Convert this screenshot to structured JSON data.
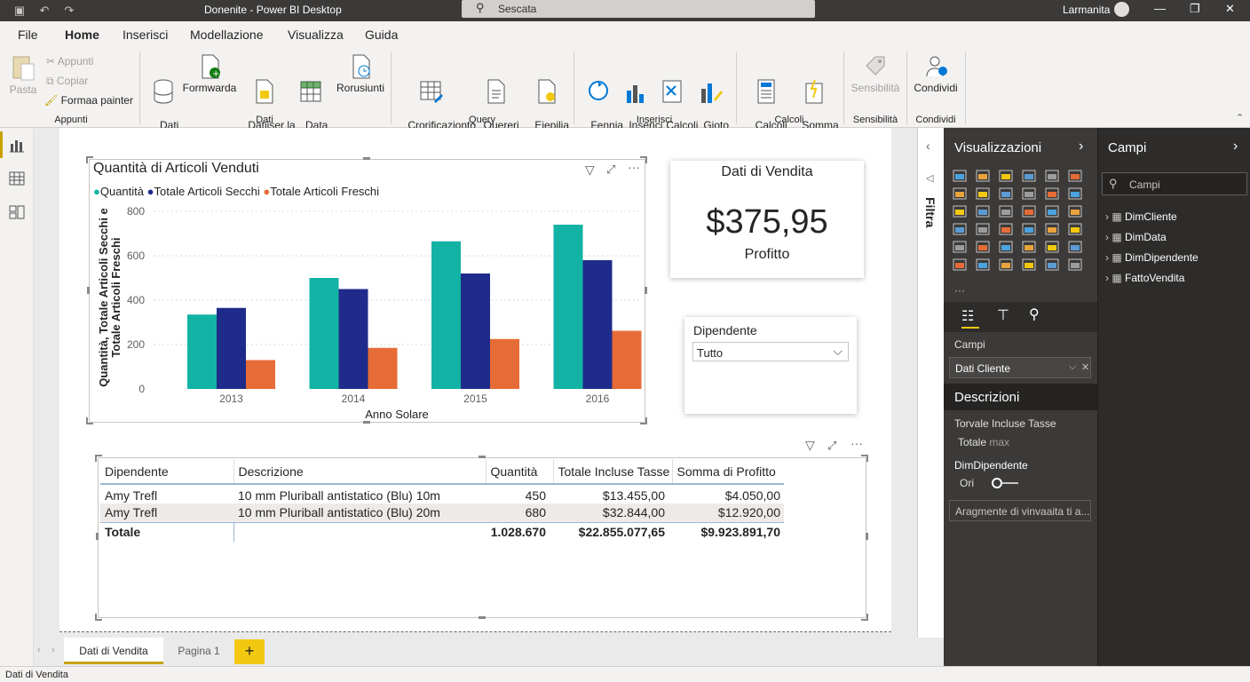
{
  "titlebar": {
    "title": "Donenite - Power BI Desktop",
    "search_placeholder": "Sescata",
    "user": "Larmanita"
  },
  "menu": {
    "tabs": [
      "File",
      "Home",
      "Inserisci",
      "Modellazione",
      "Visualizza",
      "Guida"
    ],
    "active": "Home"
  },
  "ribbon": {
    "paste": "Pasta",
    "cut": "Appunti",
    "copy": "Copiar",
    "format_painter": "Formaa painter",
    "group_clipboard": "Appunti",
    "get_data": "Dati\ndati ˅",
    "forward": "Formwarda",
    "datasets": "Datiiser la\nvato dati",
    "new_data": "Data\nnunestico",
    "recent": "Rorusiunti",
    "group_data": "Dati",
    "query_edit": "Crorificazionto\nquery ˅",
    "queries": "Quereri\nmomazioni",
    "insert_ex": "Eiepilia\ninsertorti",
    "group_query": "Query",
    "fennia": "Fennia\n˅",
    "insert": "Inserici\n˅",
    "calcoli": "Calcoli\n˅",
    "giotovani": "Gioto\nvani ˅",
    "group_insert": "Inserisci",
    "calc_cols": "Calcoli\ncoluziumi",
    "sum_profit": "Somma\ndi Profitte",
    "group_calc": "Calcoli",
    "sensitivity": "Sensibilità",
    "group_sens": "Sensibilità",
    "share": "Condividi",
    "group_share": "Condividi"
  },
  "chart_data": {
    "type": "bar",
    "title": "Quantità di Articoli Venduti",
    "categories": [
      "2013",
      "2014",
      "2015",
      "2016"
    ],
    "series": [
      {
        "name": "Quantità",
        "color": "#12b3a5",
        "values": [
          335,
          500,
          665,
          740
        ]
      },
      {
        "name": "Totale Articoli Secchi",
        "color": "#1f2b8a",
        "values": [
          365,
          450,
          520,
          580
        ]
      },
      {
        "name": "Totale Articoli Freschi",
        "color": "#e66c37",
        "values": [
          130,
          185,
          225,
          262
        ]
      }
    ],
    "xlabel": "Anno Solare",
    "ylabel": "Quantità, Totale Articoli Secchi e Totale Articoli Freschi",
    "ylim": [
      0,
      800
    ],
    "yticks": [
      "800",
      "600",
      "400",
      "200",
      "0"
    ],
    "grid": true,
    "legend": "top-left"
  },
  "kpi": {
    "title": "Dati di Vendita",
    "value": "$375,95",
    "label": "Profitto"
  },
  "slicer": {
    "title": "Dipendente",
    "value": "Tutto"
  },
  "table": {
    "headers": [
      "Dipendente",
      "Descrizione",
      "Quantità",
      "Totale Incluse Tasse",
      "Somma di Profitto"
    ],
    "rows": [
      [
        "Amy Trefl",
        "10 mm Pluriball antistatico (Blu) 10m",
        "450",
        "$13.455,00",
        "$4.050,00"
      ],
      [
        "Amy Trefl",
        "10 mm Pluriball antistatico (Blu) 20m",
        "680",
        "$32.844,00",
        "$12.920,00"
      ]
    ],
    "total": [
      "Totale",
      "",
      "1.028.670",
      "$22.855.077,65",
      "$9.923.891,70"
    ]
  },
  "filters": {
    "label": "Filtra"
  },
  "viz": {
    "title": "Visualizzazioni",
    "campi_label": "Campi",
    "field_value": "Dati Cliente",
    "desc_header": "Descrizioni",
    "desc_item": "Torvale Incluse Tasse",
    "desc_sub": "Totale",
    "desc_sub2": "max",
    "dim_label": "DimDipendente",
    "toggle_label": "Ori",
    "add_drill": "Aragmente di vinvaaita ti a..."
  },
  "fields": {
    "title": "Campi",
    "search_placeholder": "Campi",
    "items": [
      "DimCliente",
      "DimData",
      "DimDipendente",
      "FattoVendita"
    ]
  },
  "pages": {
    "tabs": [
      "Dati di Vendita",
      "Pagina 1"
    ],
    "active": "Dati di Vendita",
    "add": "+"
  },
  "status": {
    "text": "Dati di Vendita"
  }
}
